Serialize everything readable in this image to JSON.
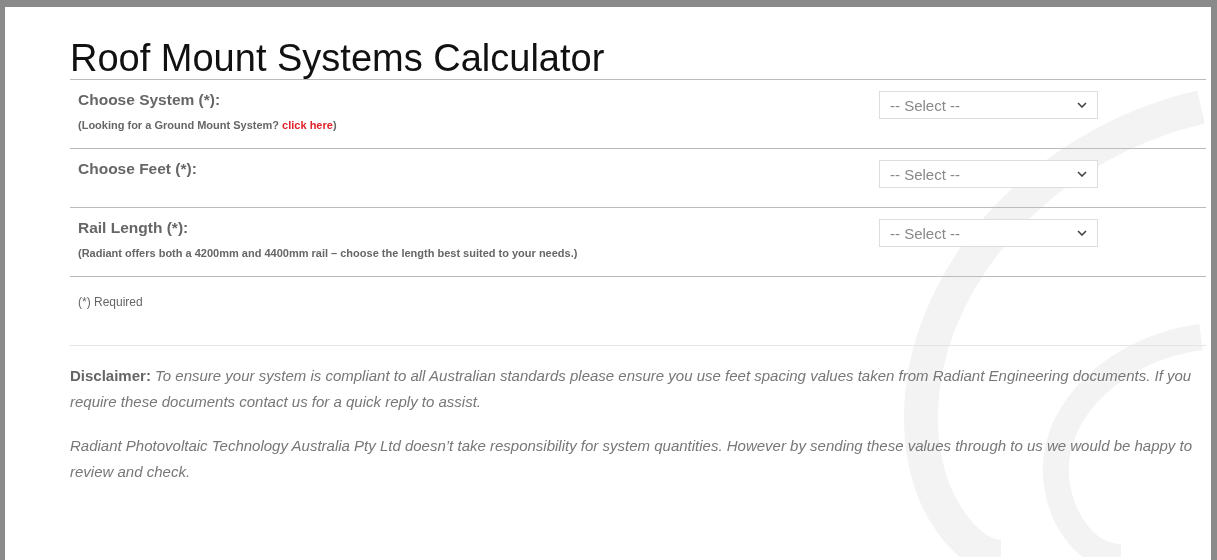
{
  "title": "Roof Mount Systems Calculator",
  "fields": [
    {
      "label": "Choose System (*):",
      "note": "(Looking for a Ground Mount System? ",
      "link": "click here",
      "note_after": ")",
      "select": "-- Select --"
    },
    {
      "label": "Choose Feet (*):",
      "select": "-- Select --"
    },
    {
      "label": "Rail Length (*):",
      "note": "(Radiant offers both a 4200mm and 4400mm rail – choose the length best suited to your needs.)",
      "select": "-- Select --"
    }
  ],
  "required_note": "(*) Required",
  "disclaimer": [
    "**Disclaimer:** *To ensure your system is compliant to all Australian standards please ensure you use feet spacing values taken from Radiant Engineering documents. If you require these documents contact us for a quick reply to assist.*",
    "Radiant Photovoltaic Technology Australia Pty Ltd doesn’t take responsibility for system quantities. However by sending these values through to us we would be happy to review and check."
  ]
}
